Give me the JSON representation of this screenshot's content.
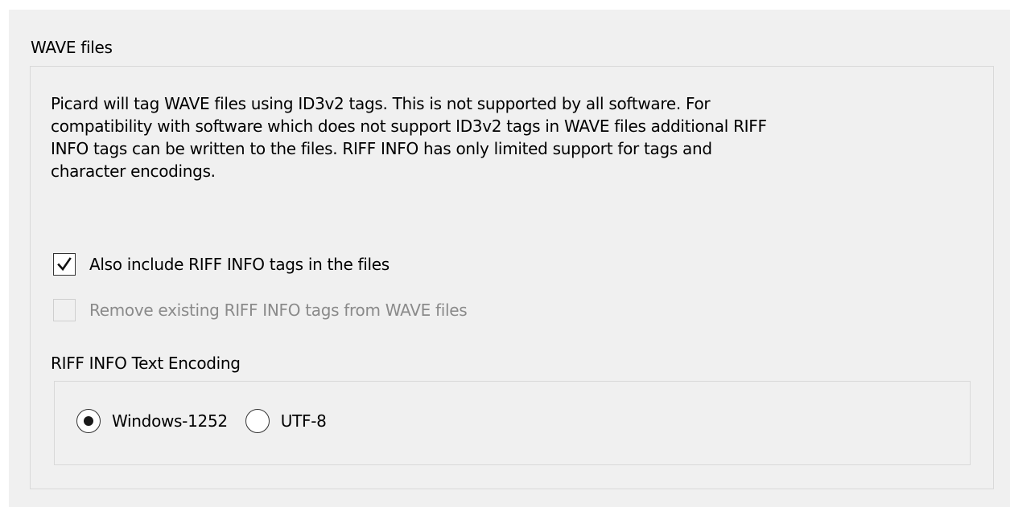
{
  "wave_group": {
    "title": "WAVE files",
    "description_lines": [
      "Picard will tag WAVE files using ID3v2 tags. This is not supported by all software. For",
      "compatibility with software which does not support ID3v2 tags in WAVE files additional RIFF",
      "INFO tags can be written to the files. RIFF INFO has only limited support for tags and",
      "character encodings."
    ],
    "include_riff": {
      "label": "Also include RIFF INFO tags in the files",
      "checked": true,
      "enabled": true
    },
    "remove_riff": {
      "label": "Remove existing RIFF INFO tags from WAVE files",
      "checked": false,
      "enabled": false
    },
    "encoding": {
      "title": "RIFF INFO Text Encoding",
      "options": [
        {
          "label": "Windows-1252",
          "selected": true
        },
        {
          "label": "UTF-8",
          "selected": false
        }
      ]
    }
  },
  "colors": {
    "panel_background": "#f0f0f0",
    "groupbox_border": "#d9d9d9",
    "disabled_text": "#8a8a8a"
  },
  "icons": {
    "checkmark": "check-icon",
    "radio_selected": "radio-dot-icon"
  }
}
